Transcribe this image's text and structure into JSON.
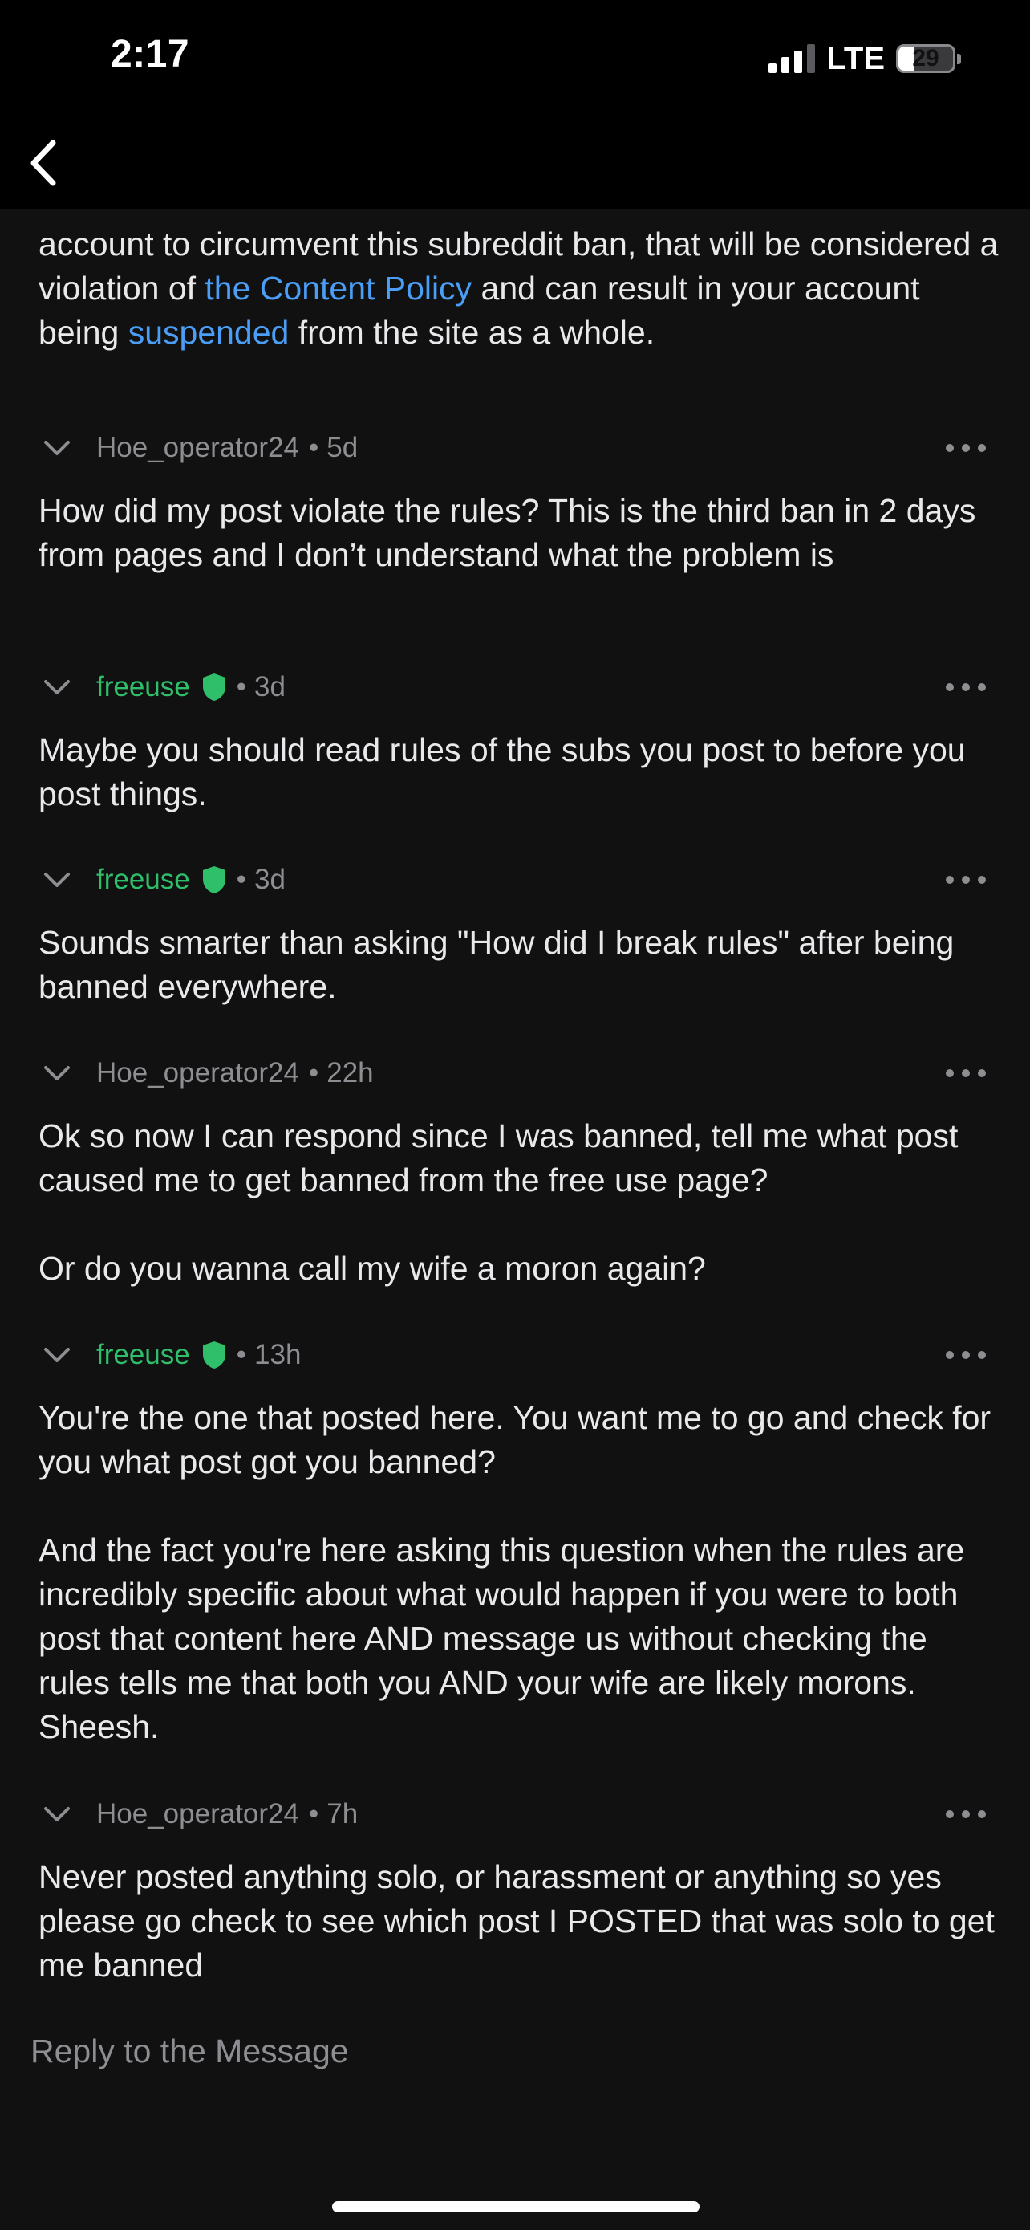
{
  "status_bar": {
    "time": "2:17",
    "network": "LTE",
    "battery_level": "29",
    "battery_fraction": 0.29
  },
  "nav": {
    "back_icon": "chevron-left-icon"
  },
  "thread": {
    "intro": {
      "text_before": "account to circumvent this subreddit ban, that will be considered a violation of ",
      "link_content_policy": "the Content Policy",
      "text_middle": " and can result in your account being ",
      "link_suspended": "suspended",
      "text_after": " from the site as a whole."
    },
    "comments": [
      {
        "author": "Hoe_operator24",
        "time": "5d",
        "paragraphs": [
          "How did my post violate the rules? This is the third ban in 2 days from pages and I don’t understand what the problem is"
        ]
      },
      {
        "author": "freeuse",
        "time": "3d",
        "paragraphs": [
          "Maybe you should read rules of the subs you post to before you post things."
        ]
      },
      {
        "author": "freeuse",
        "time": "3d",
        "paragraphs": [
          "Sounds smarter than asking \"How did I break rules\" after being banned everywhere."
        ]
      },
      {
        "author": "Hoe_operator24",
        "time": "22h",
        "paragraphs": [
          "Ok so now I can respond since I was banned, tell me what post caused me to get banned from the free use page?",
          "Or do you wanna call my wife a moron again?"
        ]
      },
      {
        "author": "freeuse",
        "time": "13h",
        "paragraphs": [
          "You're the one that posted here. You want me to go and check for you what post got you banned?",
          "And the fact you're here asking this question when the rules are incredibly specific about what would happen if you were to both post that content here AND message us without checking the rules tells me that both you AND your wife are likely morons. Sheesh."
        ]
      },
      {
        "author": "Hoe_operator24",
        "time": "7h",
        "paragraphs": [
          "Never posted anything solo, or harassment or anything so yes please go check to see which post I POSTED that was solo to get me banned"
        ]
      }
    ]
  },
  "reply": {
    "placeholder": "Reply to the Message"
  },
  "icons": {
    "collapse": "chevron-down-icon",
    "more": "more-dots-icon",
    "moderator": "shield-icon"
  },
  "colors": {
    "background": "#111112",
    "link": "#4b9ef5",
    "moderator": "#2fbf6a",
    "meta": "#8d8d92",
    "text": "#e9e9eb"
  },
  "meta": {
    "separator": "•"
  }
}
